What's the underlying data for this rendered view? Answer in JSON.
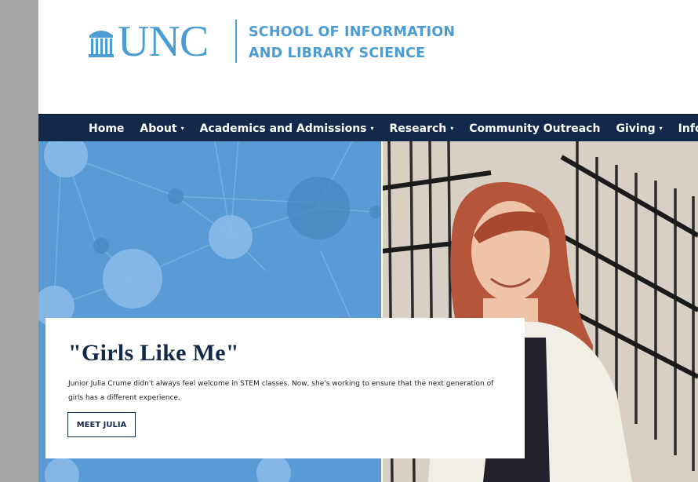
{
  "header": {
    "logo_text": "UNC",
    "school_line1": "SCHOOL OF INFORMATION",
    "school_line2": "AND LIBRARY SCIENCE",
    "brand_color": "#4b9cd3"
  },
  "nav": {
    "background": "#13294b",
    "items": [
      {
        "label": "Home",
        "dropdown": false
      },
      {
        "label": "About",
        "dropdown": true
      },
      {
        "label": "Academics and Admissions",
        "dropdown": true
      },
      {
        "label": "Research",
        "dropdown": true
      },
      {
        "label": "Community Outreach",
        "dropdown": false
      },
      {
        "label": "Giving",
        "dropdown": true
      },
      {
        "label": "Info For",
        "dropdown": true
      }
    ],
    "caret": "▾"
  },
  "hero": {
    "title": "\"Girls Like Me\"",
    "description": "Junior Julia Crume didn't always feel welcome in STEM classes. Now, she's working to ensure that the next generation of girls has a different experience.",
    "button_label": "MEET JULIA",
    "panel_color": "#5b9bd5"
  }
}
